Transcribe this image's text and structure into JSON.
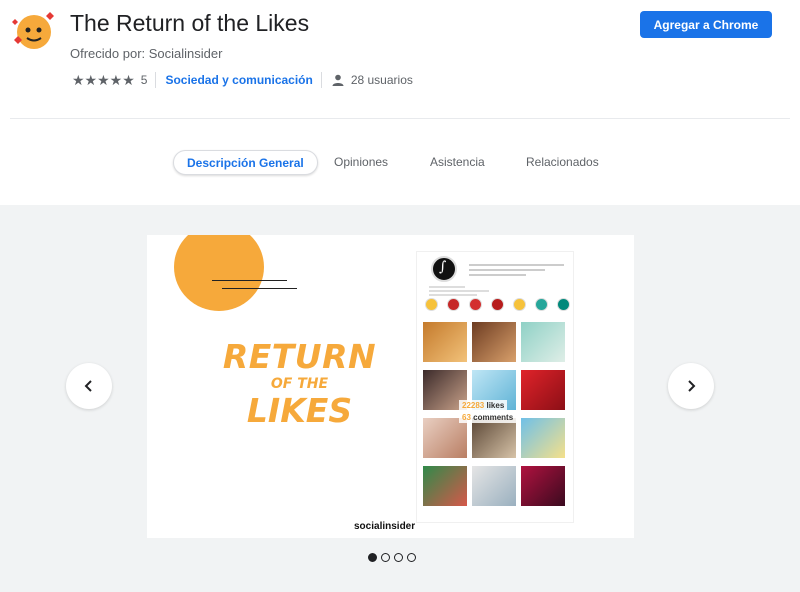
{
  "header": {
    "title": "The Return of the Likes",
    "offered_by": "Ofrecido por: Socialinsider",
    "stars": "★★★★★",
    "rating_count": "5",
    "category": "Sociedad y comunicación",
    "users": "28 usuarios",
    "add_button": "Agregar a Chrome",
    "accent_color": "#1a73e8"
  },
  "tabs": [
    {
      "label": "Descripción General",
      "active": true
    },
    {
      "label": "Opiniones",
      "active": false
    },
    {
      "label": "Asistencia",
      "active": false
    },
    {
      "label": "Relacionados",
      "active": false
    }
  ],
  "slide": {
    "line1": "RETURN",
    "line2": "OF THE",
    "line3": "LIKES",
    "likes_count": "22283",
    "likes_label": "likes",
    "comments_count": "63",
    "comments_label": "comments",
    "brand": "socialinsider",
    "accent_color": "#f6a93b"
  },
  "carousel": {
    "prev_icon": "chevron-left-icon",
    "next_icon": "chevron-right-icon",
    "dots": 4,
    "active_dot": 1
  }
}
